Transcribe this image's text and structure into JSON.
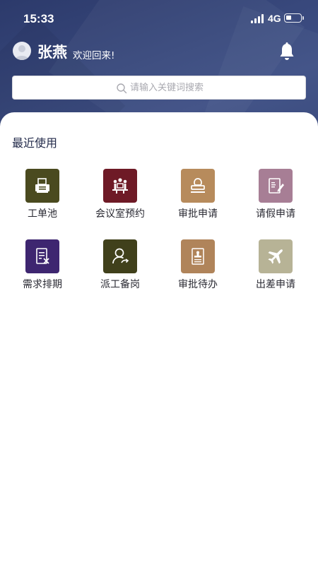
{
  "status_bar": {
    "time": "15:33",
    "network": "4G",
    "battery_level": 0.35
  },
  "header": {
    "user_name": "张燕",
    "welcome": "欢迎回来!",
    "icons": {
      "avatar": "avatar-icon",
      "notification": "bell-icon"
    }
  },
  "search": {
    "placeholder": "请输入关键词搜索",
    "value": "",
    "icon": "search-icon"
  },
  "recent": {
    "title": "最近使用",
    "items": [
      {
        "label": "工单池",
        "icon": "printer-icon",
        "color": "#4a4a1f"
      },
      {
        "label": "会议室预约",
        "icon": "meeting-icon",
        "color": "#6e1a26"
      },
      {
        "label": "审批申请",
        "icon": "stamp-icon",
        "color": "#b78b5c"
      },
      {
        "label": "请假申请",
        "icon": "leave-form-icon",
        "color": "#a77e95"
      },
      {
        "label": "需求排期",
        "icon": "schedule-doc-icon",
        "color": "#3e2670"
      },
      {
        "label": "派工备岗",
        "icon": "dispatch-person-icon",
        "color": "#40401b"
      },
      {
        "label": "审批待办",
        "icon": "todo-stamp-icon",
        "color": "#b0845a"
      },
      {
        "label": "出差申请",
        "icon": "airplane-icon",
        "color": "#b7b396"
      }
    ]
  }
}
